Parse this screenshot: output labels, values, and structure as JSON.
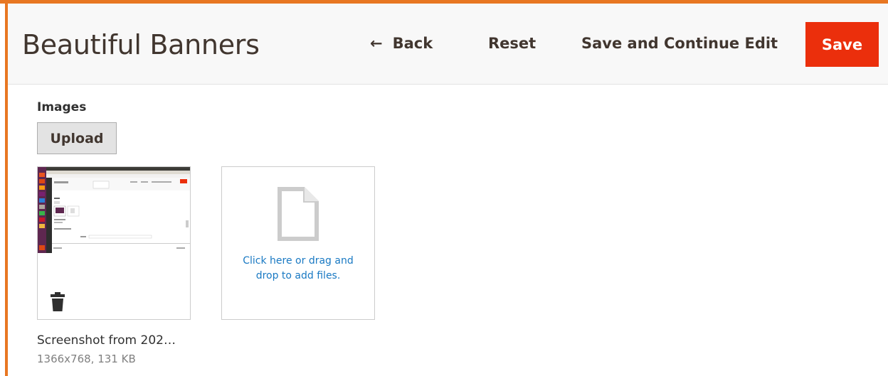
{
  "header": {
    "title": "Beautiful Banners",
    "back_label": "Back",
    "back_icon": "arrow-left-icon",
    "reset_label": "Reset",
    "save_continue_label": "Save and Continue Edit",
    "save_label": "Save"
  },
  "images": {
    "section_label": "Images",
    "upload_label": "Upload",
    "items": [
      {
        "file_name": "Screenshot from 202…",
        "meta": "1366x768, 131 KB",
        "delete_icon": "trash-icon"
      }
    ],
    "dropzone_text": "Click here or drag and drop to add files.",
    "dropzone_icon": "file-icon"
  },
  "colors": {
    "frame_accent": "#e87722",
    "save_button": "#eb2f0c",
    "link_blue": "#1979c3"
  }
}
